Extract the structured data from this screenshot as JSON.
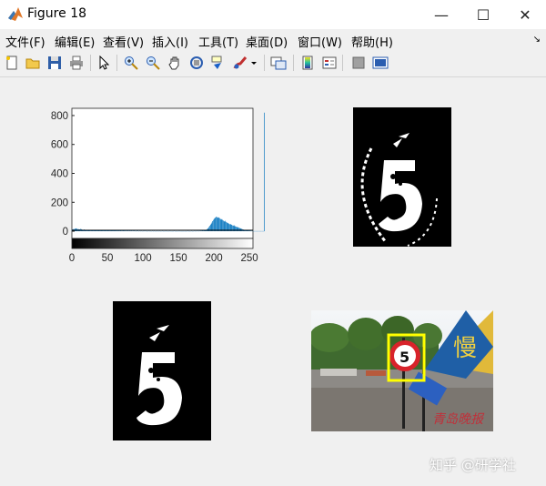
{
  "window": {
    "title": "Figure 18",
    "minimize_glyph": "—",
    "maximize_glyph": "☐",
    "close_glyph": "✕"
  },
  "menu": [
    "文件(F)",
    "编辑(E)",
    "查看(V)",
    "插入(I)",
    "工具(T)",
    "桌面(D)",
    "窗口(W)",
    "帮助(H)"
  ],
  "toolbar_icons": [
    "new-figure-icon",
    "open-file-icon",
    "save-icon",
    "print-icon",
    "select-arrow-icon",
    "zoom-in-icon",
    "zoom-out-icon",
    "pan-hand-icon",
    "rotate-3d-icon",
    "data-cursor-icon",
    "brush-icon",
    "brush-dropdown-icon",
    "link-plot-icon",
    "colorbar-icon",
    "legend-icon",
    "hide-plot-tools-icon",
    "show-plot-tools-icon"
  ],
  "chart_data": {
    "type": "bar",
    "title": "",
    "xlabel": "",
    "ylabel": "",
    "xlim": [
      0,
      255
    ],
    "ylim": [
      -50,
      850
    ],
    "yticks": [
      0,
      200,
      400,
      600,
      800
    ],
    "xticks": [
      0,
      50,
      100,
      150,
      200,
      250
    ],
    "bar_color": "#0072bd",
    "series": [
      {
        "values": [
          10,
          12,
          15,
          14,
          18,
          16,
          20,
          17,
          14,
          15,
          12,
          13,
          16,
          14,
          11,
          10,
          9,
          12,
          10,
          8,
          9,
          7,
          8,
          10,
          9,
          8,
          7,
          6,
          8,
          7,
          6,
          5,
          7,
          6,
          5,
          6,
          5,
          4,
          6,
          5,
          4,
          5,
          4,
          6,
          5,
          4,
          3,
          5,
          4,
          3,
          4,
          5,
          3,
          4,
          3,
          4,
          3,
          5,
          4,
          3,
          4,
          3,
          4,
          3,
          2,
          4,
          3,
          3,
          4,
          3,
          2,
          3,
          4,
          3,
          2,
          3,
          2,
          3,
          2,
          3,
          2,
          3,
          2,
          2,
          3,
          2,
          2,
          3,
          2,
          2,
          1,
          2,
          3,
          2,
          1,
          2,
          2,
          1,
          2,
          1,
          2,
          1,
          2,
          2,
          1,
          2,
          1,
          1,
          2,
          1,
          2,
          1,
          1,
          2,
          1,
          1,
          2,
          1,
          1,
          1,
          2,
          1,
          1,
          2,
          1,
          1,
          1,
          2,
          1,
          1,
          1,
          1,
          2,
          1,
          1,
          1,
          1,
          1,
          2,
          1,
          1,
          1,
          1,
          1,
          2,
          1,
          1,
          1,
          1,
          1,
          1,
          2,
          1,
          1,
          1,
          1,
          1,
          1,
          1,
          1,
          1,
          1,
          1,
          2,
          1,
          1,
          1,
          1,
          2,
          1,
          1,
          1,
          2,
          1,
          2,
          1,
          2,
          2,
          1,
          2,
          2,
          3,
          2,
          3,
          4,
          3,
          5,
          6,
          8,
          10,
          14,
          18,
          22,
          30,
          38,
          45,
          52,
          60,
          70,
          78,
          85,
          90,
          95,
          100,
          98,
          95,
          92,
          96,
          90,
          85,
          80,
          84,
          78,
          74,
          70,
          66,
          72,
          64,
          60,
          58,
          55,
          52,
          48,
          50,
          46,
          44,
          40,
          38,
          42,
          36,
          34,
          32,
          28,
          30,
          26,
          24,
          22,
          20,
          18,
          16,
          14,
          12,
          10,
          9,
          8,
          7,
          6,
          5,
          4,
          4,
          3,
          3,
          2,
          2,
          2,
          1,
          1,
          1,
          1,
          1,
          1,
          1,
          1,
          1,
          1,
          1,
          1,
          1,
          1,
          1,
          1,
          820
        ]
      }
    ]
  },
  "images": [
    {
      "name": "binary-edge-image",
      "desc_glyph": "5"
    },
    {
      "name": "binary-digit-image",
      "desc_glyph": "5"
    },
    {
      "name": "detected-sign-photo",
      "sign_text": "慢",
      "watermark_text": "青岛晚报"
    }
  ],
  "watermark": "知乎 @研学社"
}
